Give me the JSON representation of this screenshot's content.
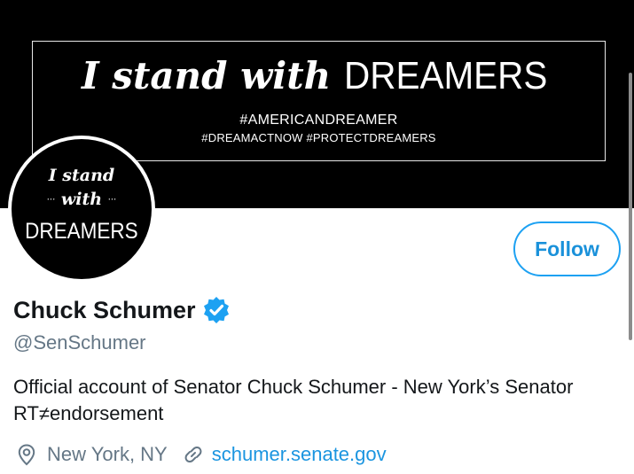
{
  "banner": {
    "headline_script": "I stand with",
    "headline_caps": "DREAMERS",
    "tagline_1": "#AMERICANDREAMER",
    "tagline_2": "#DREAMACTNOW #PROTECTDREAMERS"
  },
  "avatar": {
    "line1": "I stand",
    "line2": "with",
    "line2_dots": "···",
    "line3": "DREAMERS"
  },
  "profile": {
    "display_name": "Chuck Schumer",
    "verified_icon": "verified-badge-icon",
    "handle": "@SenSchumer",
    "bio": "Official account of Senator Chuck Schumer - New York’s Senator RT≠endorsement",
    "location": "New York, NY",
    "location_icon": "location-pin-icon",
    "website": "schumer.senate.gov",
    "website_icon": "link-icon"
  },
  "actions": {
    "follow_label": "Follow"
  },
  "colors": {
    "accent": "#1da1f2",
    "link": "#1b95e0",
    "secondary_text": "#657786",
    "primary_text": "#14171a",
    "banner_bg": "#000000"
  }
}
